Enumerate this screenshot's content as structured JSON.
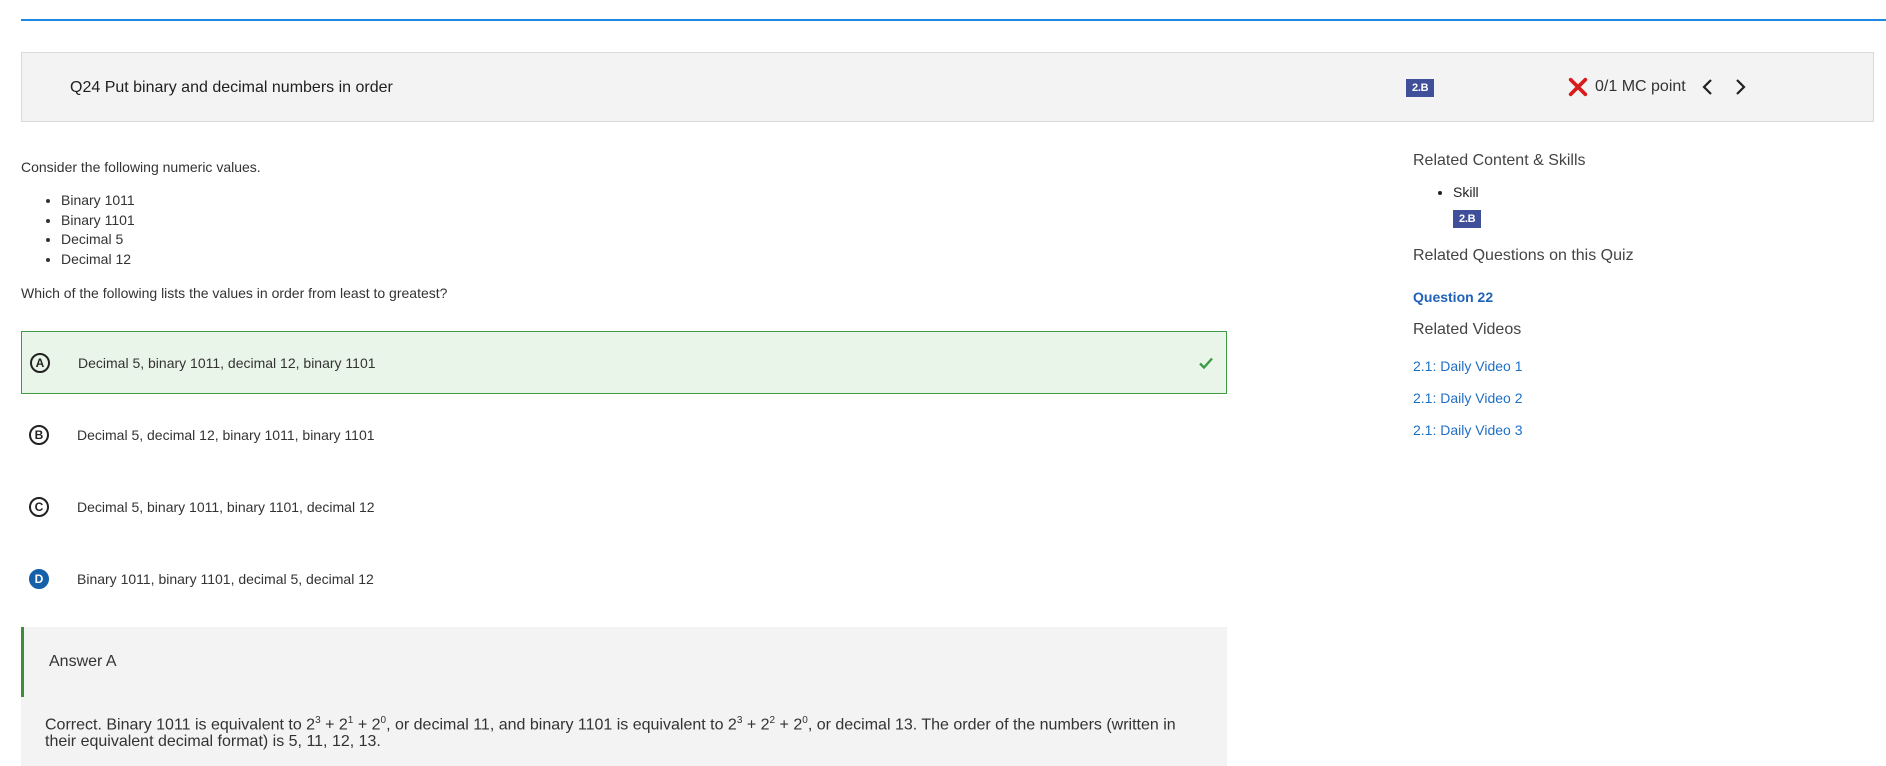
{
  "header": {
    "title": "Q24 Put binary and decimal numbers in order",
    "skill_badge": "2.B",
    "score": "0/1 MC point"
  },
  "question": {
    "prompt": "Consider the following numeric values.",
    "values": [
      "Binary 1011",
      "Binary 1101",
      "Decimal 5",
      "Decimal 12"
    ],
    "ask": "Which of the following lists the values in order from least to greatest?"
  },
  "choices": [
    {
      "letter": "A",
      "text": "Decimal 5, binary 1011, decimal 12, binary 1101"
    },
    {
      "letter": "B",
      "text": "Decimal 5, decimal 12, binary 1011, binary 1101"
    },
    {
      "letter": "C",
      "text": "Decimal 5, binary 1011, binary 1101, decimal 12"
    },
    {
      "letter": "D",
      "text": "Binary 1011, binary 1101, decimal 5, decimal 12"
    }
  ],
  "answer": {
    "title": "Answer A",
    "exp_1": "Correct. Binary 1011 is equivalent to 2",
    "exp_2": ", or decimal 11, and binary 1101 is equivalent to 2",
    "exp_3": ", or decimal 13. The order of the numbers (written in their equivalent decimal format) is 5, 11, 12, 13.",
    "plus": "+",
    "exp_a": "3",
    "exp_b": "1",
    "exp_c": "0",
    "exp_d": "3",
    "exp_e": "2",
    "exp_f": "0",
    "base": "2"
  },
  "sidebar": {
    "related_content_heading": "Related Content & Skills",
    "skill_label": "Skill",
    "skill_badge": "2.B",
    "related_questions_heading": "Related Questions on this Quiz",
    "related_question": "Question 22",
    "related_videos_heading": "Related Videos",
    "videos": [
      "2.1: Daily Video 1",
      "2.1: Daily Video 2",
      "2.1: Daily Video 3"
    ]
  },
  "colors": {
    "accent_blue": "#1e88e5",
    "correct_green": "#3e9b44",
    "badge_blue": "#3f4f9a",
    "wrong_red": "#d81b1b",
    "link_blue": "#1f6fc5"
  }
}
